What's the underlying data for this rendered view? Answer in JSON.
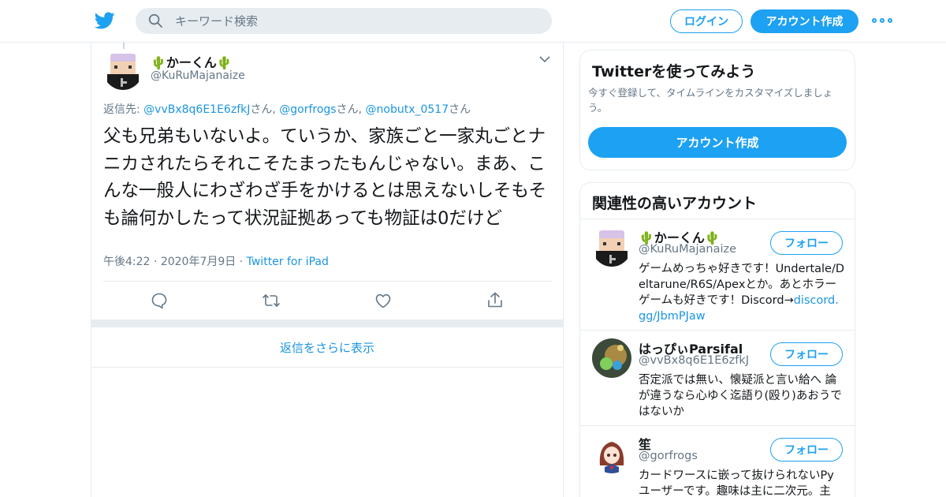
{
  "header": {
    "search_placeholder": "キーワード検索",
    "login_label": "ログイン",
    "signup_label": "アカウント作成"
  },
  "tweet": {
    "name": "🌵かーくん🌵",
    "handle": "@KuRuMajanaize",
    "replying_prefix": "返信先: ",
    "replying_to": [
      {
        "handle": "@vvBx8q6E1E6zfkJ",
        "suffix": "さん, "
      },
      {
        "handle": "@gorfrogs",
        "suffix": "さん, "
      },
      {
        "handle": "@nobutx_0517",
        "suffix": "さん"
      }
    ],
    "text": "父も兄弟もいないよ。ていうか、家族ごと一家丸ごとナニカされたらそれこそたまったもんじゃない。まあ、こんな一般人にわざわざ手をかけるとは思えないしそもそも論何かしたって状況証拠あっても物証は0だけど",
    "time": "午後4:22",
    "date": "2020年7月9日",
    "source": "Twitter for iPad",
    "show_more_replies": "返信をさらに表示"
  },
  "signup_card": {
    "title": "Twitterを使ってみよう",
    "description": "今すぐ登録して、タイムラインをカスタマイズしましょう。",
    "button": "アカウント作成"
  },
  "related": {
    "title": "関連性の高いアカウント",
    "follow_label": "フォロー",
    "accounts": [
      {
        "name": "🌵かーくん🌵",
        "handle": "@KuRuMajanaize",
        "bio": "ゲームめっちゃ好きです！Undertale/Deltarune/R6S/Apexとか。あとホラーゲームも好きです！Discord→",
        "bio_link": "discord.gg/JbmPJaw"
      },
      {
        "name": "はっぴぃParsifal",
        "handle": "@vvBx8q6E1E6zfkJ",
        "bio": "否定派では無い、懐疑派と言い給へ 論が違うなら心ゆく迄語り(殴り)あおうではないか"
      },
      {
        "name": "笙",
        "handle": "@gorfrogs",
        "bio": "カードワースに嵌って抜けられないPyユーザーです。趣味は主に二次元。主"
      }
    ]
  },
  "colors": {
    "accent": "#1da1f2",
    "link": "#1b95e0",
    "muted": "#657786",
    "border": "#e6ecf0"
  },
  "icons": {
    "logo": "twitter-bird-icon",
    "search": "search-icon",
    "more": "more-dots-icon",
    "caret": "chevron-down-icon",
    "reply": "reply-icon",
    "retweet": "retweet-icon",
    "like": "heart-icon",
    "share": "share-icon"
  }
}
